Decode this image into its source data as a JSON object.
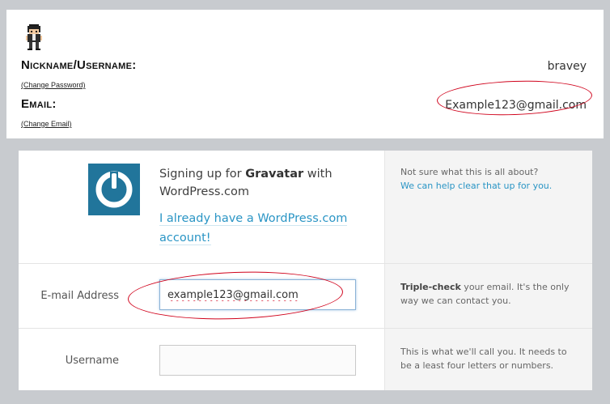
{
  "profile": {
    "nickname_label": "Nickname/Username:",
    "nickname_value": "bravey",
    "change_password": "(Change Password)",
    "email_label": "Email:",
    "email_value": "Example123@gmail.com",
    "change_email": "(Change Email)"
  },
  "signup": {
    "heading_prefix": "Signing up for ",
    "heading_brand": "Gravatar",
    "heading_suffix": " with WordPress.com",
    "existing_account_link": "I already have a WordPress.com account!",
    "help_question": "Not sure what this is all about?",
    "help_link": "We can help clear that up for you.",
    "email_label": "E-mail Address",
    "email_value": "example123@gmail.com",
    "email_hint_bold": "Triple-check",
    "email_hint_rest": " your email. It's the only way we can contact you.",
    "username_label": "Username",
    "username_value": "",
    "username_hint": "This is what we'll call you. It needs to be a least four letters or numbers."
  },
  "colors": {
    "annotation": "#d0021b",
    "wordpress_blue": "#21759b",
    "link": "#2a95c5"
  },
  "icons": {
    "avatar": "pixel-character-avatar",
    "logo": "wordpress-power-logo"
  }
}
